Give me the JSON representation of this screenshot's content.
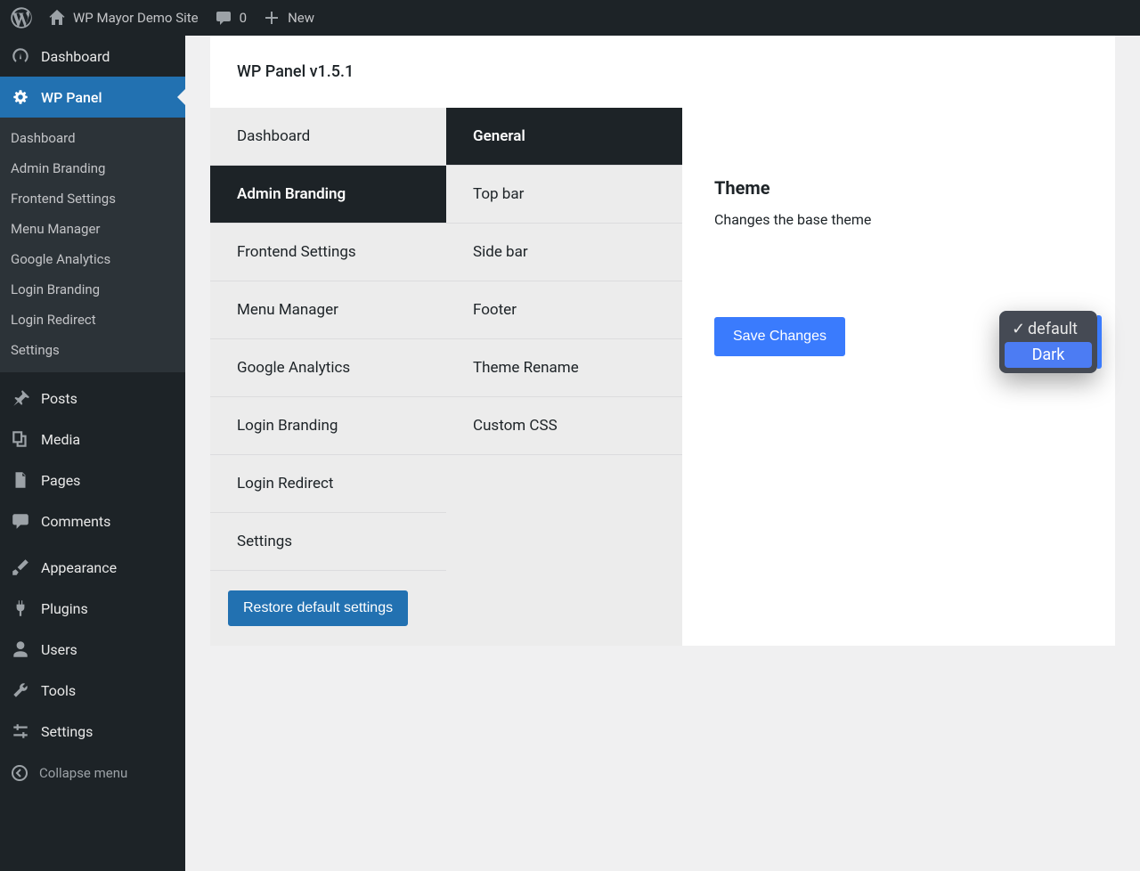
{
  "adminbar": {
    "site_name": "WP Mayor Demo Site",
    "comments_count": "0",
    "new_label": "New"
  },
  "adminmenu": {
    "top": [
      {
        "id": "dashboard",
        "label": "Dashboard",
        "icon": "gauge"
      },
      {
        "id": "wp-panel",
        "label": "WP Panel",
        "icon": "gear",
        "current": true,
        "submenu": [
          "Dashboard",
          "Admin Branding",
          "Frontend Settings",
          "Menu Manager",
          "Google Analytics",
          "Login Branding",
          "Login Redirect",
          "Settings"
        ]
      },
      {
        "id": "posts",
        "label": "Posts",
        "icon": "pin"
      },
      {
        "id": "media",
        "label": "Media",
        "icon": "media"
      },
      {
        "id": "pages",
        "label": "Pages",
        "icon": "page"
      },
      {
        "id": "comments",
        "label": "Comments",
        "icon": "comment"
      },
      {
        "id": "appearance",
        "label": "Appearance",
        "icon": "brush"
      },
      {
        "id": "plugins",
        "label": "Plugins",
        "icon": "plug"
      },
      {
        "id": "users",
        "label": "Users",
        "icon": "user"
      },
      {
        "id": "tools",
        "label": "Tools",
        "icon": "wrench"
      },
      {
        "id": "settings",
        "label": "Settings",
        "icon": "sliders"
      }
    ],
    "collapse_label": "Collapse menu"
  },
  "panel": {
    "header": "WP Panel v1.5.1",
    "tabs_primary": [
      "Dashboard",
      "Admin Branding",
      "Frontend Settings",
      "Menu Manager",
      "Google Analytics",
      "Login Branding",
      "Login Redirect",
      "Settings"
    ],
    "tabs_primary_active": "Admin Branding",
    "tabs_secondary": [
      "General",
      "Top bar",
      "Side bar",
      "Footer",
      "Theme Rename",
      "Custom CSS"
    ],
    "tabs_secondary_active": "General",
    "restore_label": "Restore default settings",
    "setting": {
      "title": "Theme",
      "description": "Changes the base theme"
    },
    "save_label": "Save Changes"
  },
  "dropdown": {
    "options": [
      "default",
      "Dark"
    ],
    "selected": "default",
    "highlighted": "Dark"
  }
}
